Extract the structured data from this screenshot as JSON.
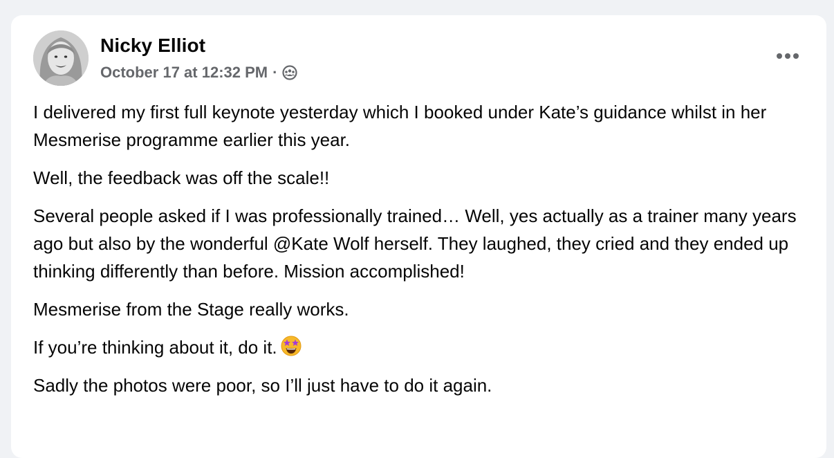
{
  "post": {
    "author_name": "Nicky Elliot",
    "timestamp": "October 17 at 12:32 PM",
    "separator": "·",
    "audience_icon": "group-audience-icon",
    "more_icon": "more-horizontal-icon",
    "paragraphs": [
      "I delivered my first full keynote yesterday which I booked under Kate’s guidance whilst in her Mesmerise programme earlier this year.",
      "Well, the feedback was off the scale!!",
      "Several people asked if I was professionally trained… Well, yes actually as a trainer many years ago but also by the wonderful @Kate Wolf herself. They laughed, they cried and they ended up thinking differently than before. Mission accomplished!",
      "Mesmerise from the Stage really works.",
      "If you’re thinking about it, do it.",
      "Sadly the photos were poor, so I’ll just have to do it again."
    ],
    "emoji_icon": "star-struck-emoji-icon"
  },
  "colors": {
    "page_background": "#f0f2f5",
    "card_background": "#ffffff",
    "primary_text": "#050505",
    "secondary_text": "#65676b"
  }
}
